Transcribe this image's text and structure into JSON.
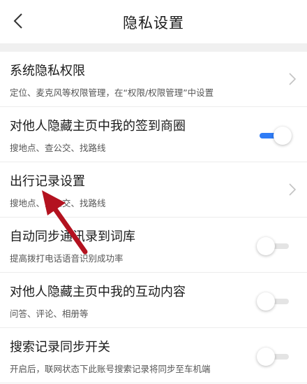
{
  "header": {
    "title": "隐私设置",
    "back_icon": "chevron-left-icon"
  },
  "items": [
    {
      "title": "系统隐私权限",
      "subtitle": "定位、麦克风等权限管理，在“权限/权限管理”中设置",
      "control": "chevron"
    },
    {
      "title": "对他人隐藏主页中我的签到商圈",
      "subtitle": "搜地点、查公交、找路线",
      "control": "toggle",
      "state": "on"
    },
    {
      "title": "出行记录设置",
      "subtitle": "搜地点、查公交、找路线",
      "control": "chevron"
    },
    {
      "title": "自动同步通讯录到词库",
      "subtitle": "提高拨打电话语音识别成功率",
      "control": "toggle",
      "state": "off"
    },
    {
      "title": "对他人隐藏主页中我的互动内容",
      "subtitle": "问答、评论、相册等",
      "control": "toggle",
      "state": "off"
    },
    {
      "title": "搜索记录同步开关",
      "subtitle": "开启后，联网状态下此账号搜索记录将同步至车机端",
      "control": "toggle",
      "state": "off"
    }
  ],
  "colors": {
    "accent": "#2f7cf6",
    "annotation_arrow": "#b3121f"
  }
}
